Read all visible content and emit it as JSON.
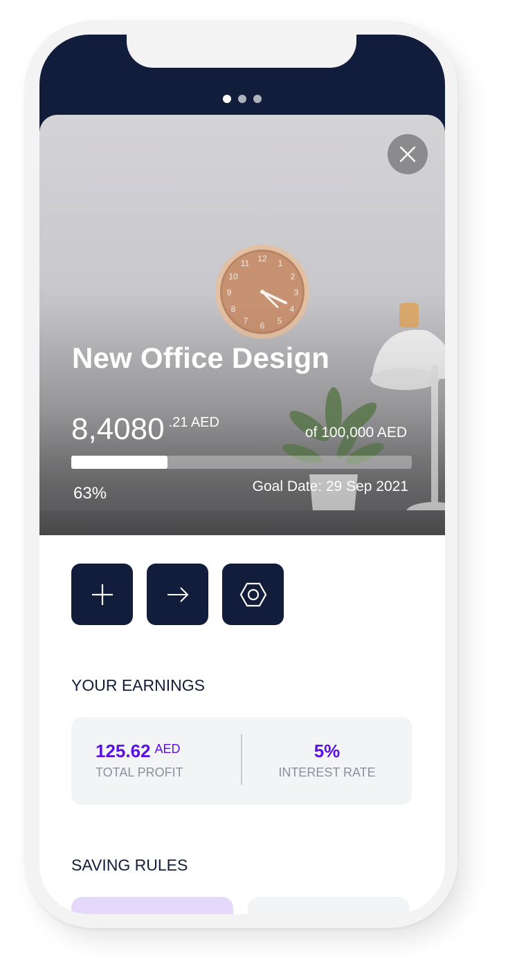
{
  "pagination": {
    "total": 3,
    "active": 0
  },
  "goal": {
    "title": "New Office Design",
    "saved_main": "8,4080",
    "saved_fraction": ".21 AED",
    "target": "of 100,000 AED",
    "progress_percent": 63,
    "progress_label": "63%",
    "goal_date": "Goal Date: 29 Sep 2021"
  },
  "actions": [
    {
      "name": "add-money-button",
      "icon": "plus-icon"
    },
    {
      "name": "transfer-button",
      "icon": "arrow-right-icon"
    },
    {
      "name": "settings-button",
      "icon": "hexagon-gear-icon"
    }
  ],
  "earnings": {
    "heading": "YOUR EARNINGS",
    "total_profit_value": "125.62",
    "total_profit_unit": "AED",
    "total_profit_label": "TOTAL PROFIT",
    "interest_rate_value": "5%",
    "interest_rate_label": "INTEREST RATE"
  },
  "saving_rules": {
    "heading": "SAVING RULES"
  },
  "colors": {
    "navy": "#121d3c",
    "accent_purple": "#5b12e0",
    "card_bg": "#f3f4f6",
    "rule_purple": "#e4d8fb"
  }
}
